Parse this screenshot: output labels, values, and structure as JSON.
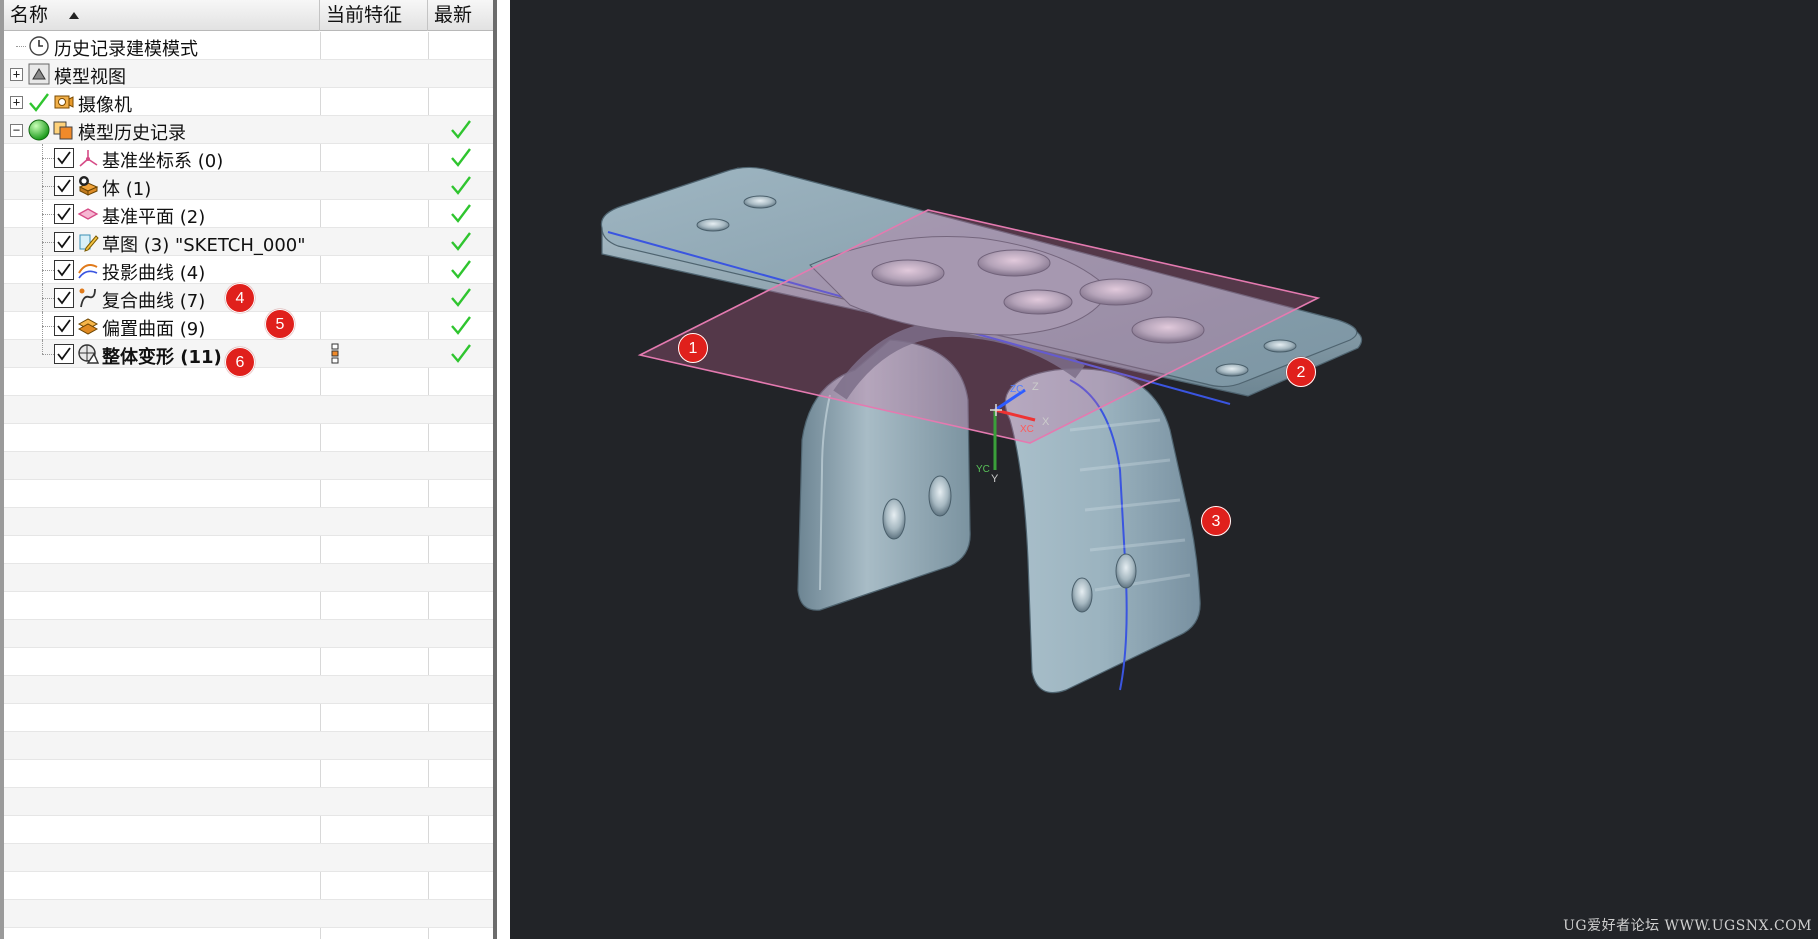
{
  "navigator": {
    "columns": {
      "name": "名称",
      "current_feature": "当前特征",
      "latest": "最新"
    },
    "rows": [
      {
        "label": "历史记录建模模式",
        "icon": "history-clock-icon"
      },
      {
        "label": "模型视图",
        "icon": "model-view-icon",
        "expander": "+"
      },
      {
        "label": "摄像机",
        "icon": "camera-icon",
        "expander": "+"
      },
      {
        "label": "模型历史记录",
        "icon": "model-history-icon",
        "expander": "−",
        "latest": true
      },
      {
        "label": "基准坐标系 (0)",
        "icon": "datum-csys-icon",
        "latest": true
      },
      {
        "label": "体 (1)",
        "icon": "body-icon",
        "latest": true
      },
      {
        "label": "基准平面 (2)",
        "icon": "datum-plane-icon",
        "latest": true
      },
      {
        "label": "草图 (3) \"SKETCH_000\"",
        "icon": "sketch-icon",
        "latest": true
      },
      {
        "label": "投影曲线 (4)",
        "icon": "projected-curve-icon",
        "latest": true
      },
      {
        "label": "复合曲线 (7)",
        "icon": "composite-curve-icon",
        "latest": true
      },
      {
        "label": "偏置曲面 (9)",
        "icon": "offset-surface-icon",
        "latest": true
      },
      {
        "label": "整体变形 (11)",
        "icon": "global-shaping-icon",
        "latest": true,
        "current": true
      }
    ]
  },
  "badges": [
    "1",
    "2",
    "3",
    "4",
    "5",
    "6"
  ],
  "viewport": {
    "background": "#222428",
    "triad": {
      "zc": "ZC",
      "z": "Z",
      "xc": "XC",
      "x": "X",
      "yc": "YC",
      "y": "Y"
    },
    "watermark": "UG爱好者论坛 WWW.UGSNX.COM"
  },
  "colors": {
    "badge": "#e0201c",
    "check": "#2fc52f",
    "datum_plane": "#e47ab0",
    "curve": "#3a55e0"
  }
}
